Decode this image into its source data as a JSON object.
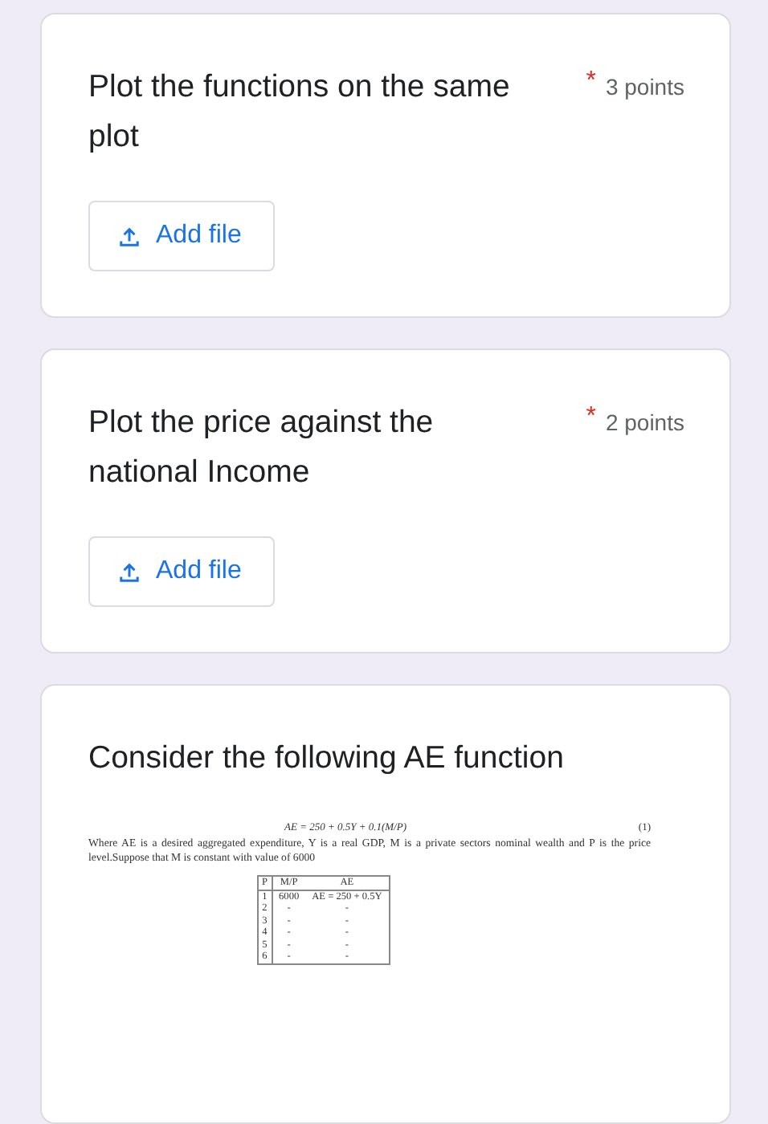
{
  "questions": [
    {
      "kind": "upload",
      "title": "Plot the functions on the same plot",
      "required": true,
      "required_mark": "*",
      "points": "3 points",
      "button": "Add file"
    },
    {
      "kind": "upload",
      "title": "Plot the price against the national Income",
      "required": true,
      "required_mark": "*",
      "points": "2 points",
      "button": "Add file"
    },
    {
      "kind": "image",
      "title": "Consider the following AE function",
      "image": {
        "equation": "AE = 250 + 0.5Y + 0.1(M/P)",
        "equation_number": "(1)",
        "text": "Where AE is a desired aggregated expenditure, Y is a real GDP, M is a private sectors nominal wealth and P is the price level.Suppose that M is constant with value of 6000",
        "table": {
          "columns": [
            "P",
            "M/P",
            "AE"
          ],
          "rows": [
            [
              "1",
              "6000",
              "AE = 250 + 0.5Y"
            ],
            [
              "2",
              "-",
              "-"
            ],
            [
              "3",
              "-",
              "-"
            ],
            [
              "4",
              "-",
              "-"
            ],
            [
              "5",
              "-",
              "-"
            ],
            [
              "6",
              "-",
              "-"
            ]
          ]
        }
      }
    }
  ]
}
